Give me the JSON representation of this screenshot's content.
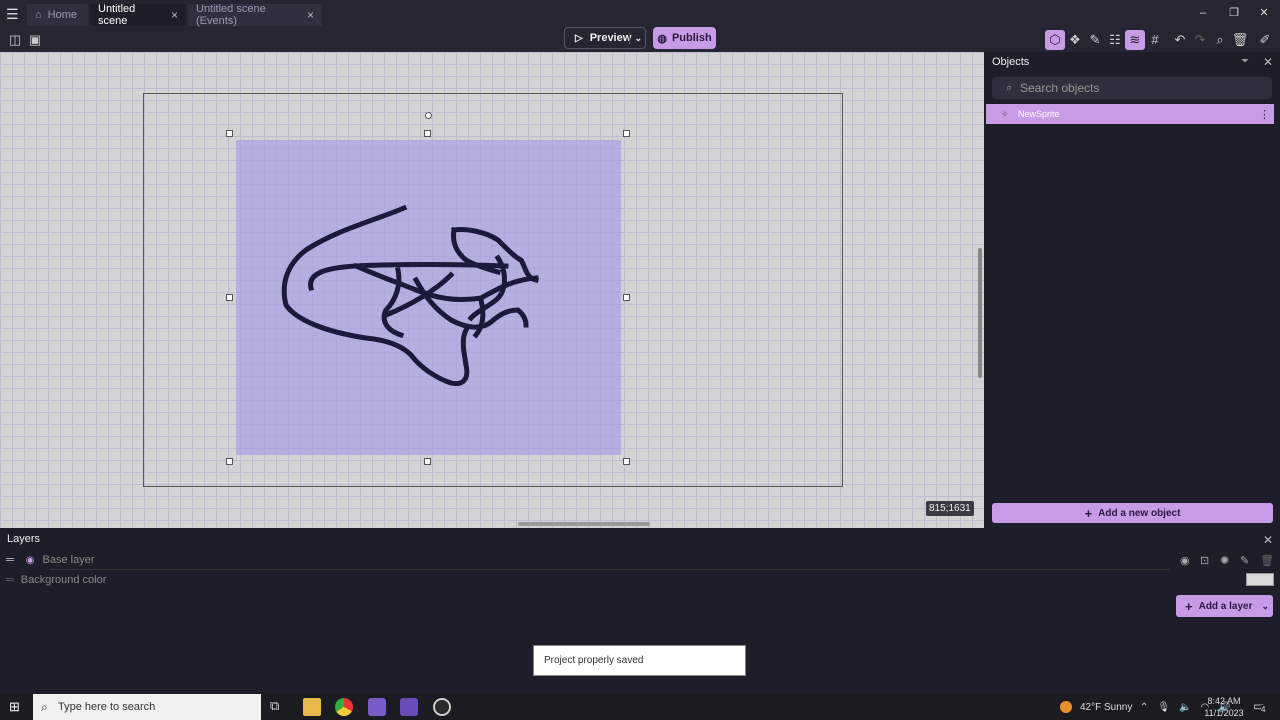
{
  "tabs": [
    {
      "label": "Home"
    },
    {
      "label": "Untitled scene"
    },
    {
      "label": "Untitled scene (Events)"
    }
  ],
  "toolbar": {
    "preview_label": "Preview",
    "publish_label": "Publish"
  },
  "canvas": {
    "coords": "815;1631"
  },
  "objects": {
    "title": "Objects",
    "search_placeholder": "Search objects",
    "items": [
      {
        "label": "NewSprite"
      }
    ],
    "add_label": "Add a new object"
  },
  "layers": {
    "title": "Layers",
    "base_layer": "Base layer",
    "background_color": "Background color",
    "add_label": "Add a layer"
  },
  "toast": "Project properly saved",
  "taskbar": {
    "search_placeholder": "Type here to search",
    "weather": "42°F  Sunny",
    "time": "8:42 AM",
    "date": "11/1/2023",
    "notif_count": "4"
  },
  "colors": {
    "accent": "#c79be6",
    "background": "#1e1e2a",
    "sprite_fill": "#a8a0e6"
  }
}
